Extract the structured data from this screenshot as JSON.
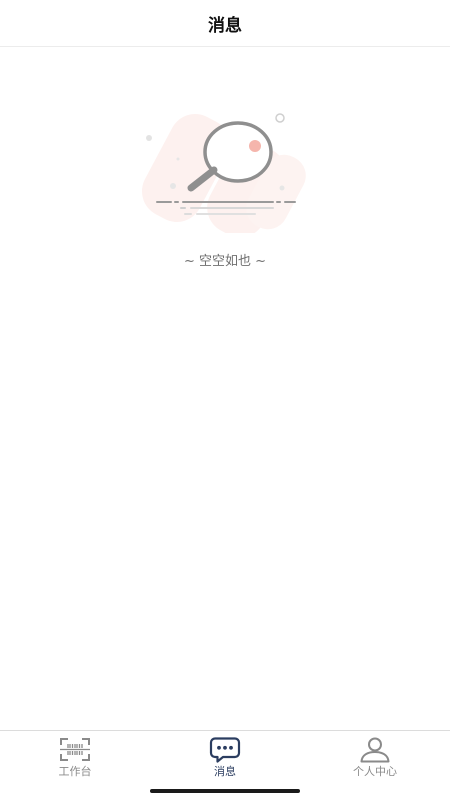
{
  "header": {
    "title": "消息"
  },
  "empty_state": {
    "message": "~ 空空如也 ~",
    "icon": "magnifier-illustration"
  },
  "tab_bar": {
    "tabs": [
      {
        "label": "工作台",
        "icon": "barcode-scan-icon",
        "active": false
      },
      {
        "label": "消息",
        "icon": "chat-bubble-icon",
        "active": true
      },
      {
        "label": "个人中心",
        "icon": "user-icon",
        "active": false
      }
    ]
  },
  "colors": {
    "active": "#2b3d60",
    "inactive": "#8a8a8a",
    "accent_pink": "#f5b5ac"
  }
}
